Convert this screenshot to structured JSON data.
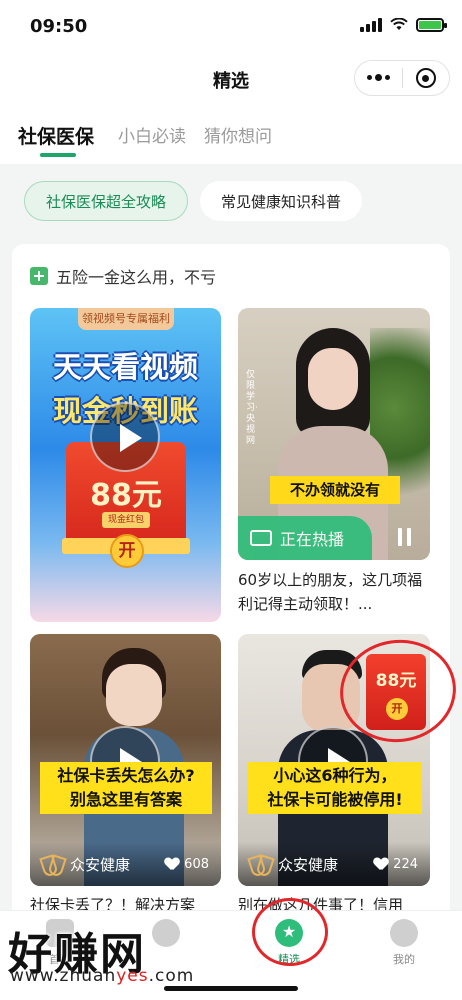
{
  "status": {
    "time": "09:50"
  },
  "nav": {
    "title": "精选"
  },
  "tabs": [
    {
      "label": "社保医保",
      "active": true
    },
    {
      "label": "小白必读",
      "active": false
    },
    {
      "label": "猜你想问",
      "active": false
    }
  ],
  "chips": [
    {
      "label": "社保医保超全攻略",
      "active": true
    },
    {
      "label": "常见健康知识科普",
      "active": false
    }
  ],
  "section": {
    "title": "五险一金这么用，不亏"
  },
  "videos": [
    {
      "ribbon": "领视频号专属福利",
      "headline1": "天天看视频",
      "headline2": "现金秒到账",
      "amount": "88元",
      "envelope_label": "现金红包",
      "open_label": "开"
    },
    {
      "side_text": "仅限学习·央视网",
      "caption": "不办领就没有",
      "hot_label": "正在热播",
      "title": "60岁以上的朋友，这几项福利记得主动领取！..."
    },
    {
      "caption_line1": "社保卡丢失怎么办?",
      "caption_line2": "别急这里有答案",
      "brand": "众安健康",
      "likes": "608",
      "title": "社保卡丢了？！解决方案"
    },
    {
      "caption_line1": "小心这6种行为，",
      "caption_line2": "社保卡可能被停用!",
      "envelope_amount": "88元",
      "envelope_open": "开",
      "brand": "众安健康",
      "likes": "224",
      "title": "别在做这几件事了！信用"
    }
  ],
  "tabbar": [
    {
      "label": "首页",
      "icon": "home-icon"
    },
    {
      "label": "",
      "icon": "circle-icon"
    },
    {
      "label": "精选",
      "icon": "star-icon",
      "active": true
    },
    {
      "label": "我的",
      "icon": "user-icon"
    }
  ],
  "watermark": {
    "text": "好赚网",
    "url_prefix": "www.zhuan",
    "url_accent": "yes",
    "url_suffix": ".com"
  },
  "colors": {
    "accent": "#1ea56a",
    "annotation": "#e3262a",
    "caption_yellow": "#ffe01a"
  }
}
